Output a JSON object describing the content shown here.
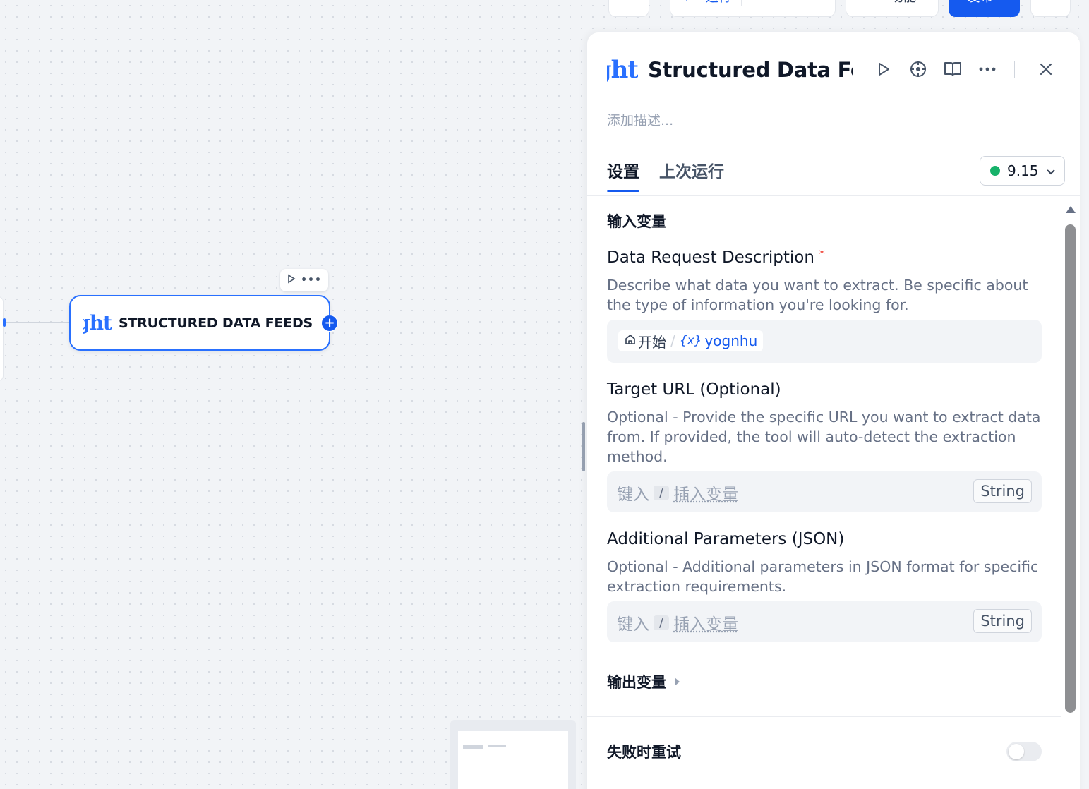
{
  "toolbar": {
    "run_label": "运行",
    "features_label": "功能",
    "publish_label": "发布"
  },
  "canvas": {
    "node": {
      "logo_text": "ght",
      "title": "STRUCTURED DATA FEEDS"
    }
  },
  "panel": {
    "logo_text": "ght",
    "title": "Structured Data Feeds",
    "description_placeholder": "添加描述...",
    "tabs": [
      {
        "label": "设置",
        "active": true
      },
      {
        "label": "上次运行",
        "active": false
      }
    ],
    "version": "9.15",
    "version_status_color": "#17b26a",
    "input_section_title": "输入变量",
    "fields": [
      {
        "label": "Data Request Description",
        "required_mark": "*",
        "help": "Describe what data you want to extract. Be specific about the type of information you're looking for.",
        "chip": {
          "source": "开始",
          "separator": "/",
          "var_icon": "{x}",
          "var_name": "yognhu"
        }
      },
      {
        "label": "Target URL (Optional)",
        "help": "Optional - Provide the specific URL you want to extract data from. If provided, the tool will auto-detect the extraction method.",
        "placeholder_prefix": "键入",
        "placeholder_key": "/",
        "placeholder_suffix": "插入变量",
        "type": "String"
      },
      {
        "label": "Additional Parameters (JSON)",
        "help": "Optional - Additional parameters in JSON format for specific extraction requirements.",
        "placeholder_prefix": "键入",
        "placeholder_key": "/",
        "placeholder_suffix": "插入变量",
        "type": "String"
      }
    ],
    "output_section_title": "输出变量",
    "retry_label": "失败时重试",
    "retry_enabled": false
  }
}
